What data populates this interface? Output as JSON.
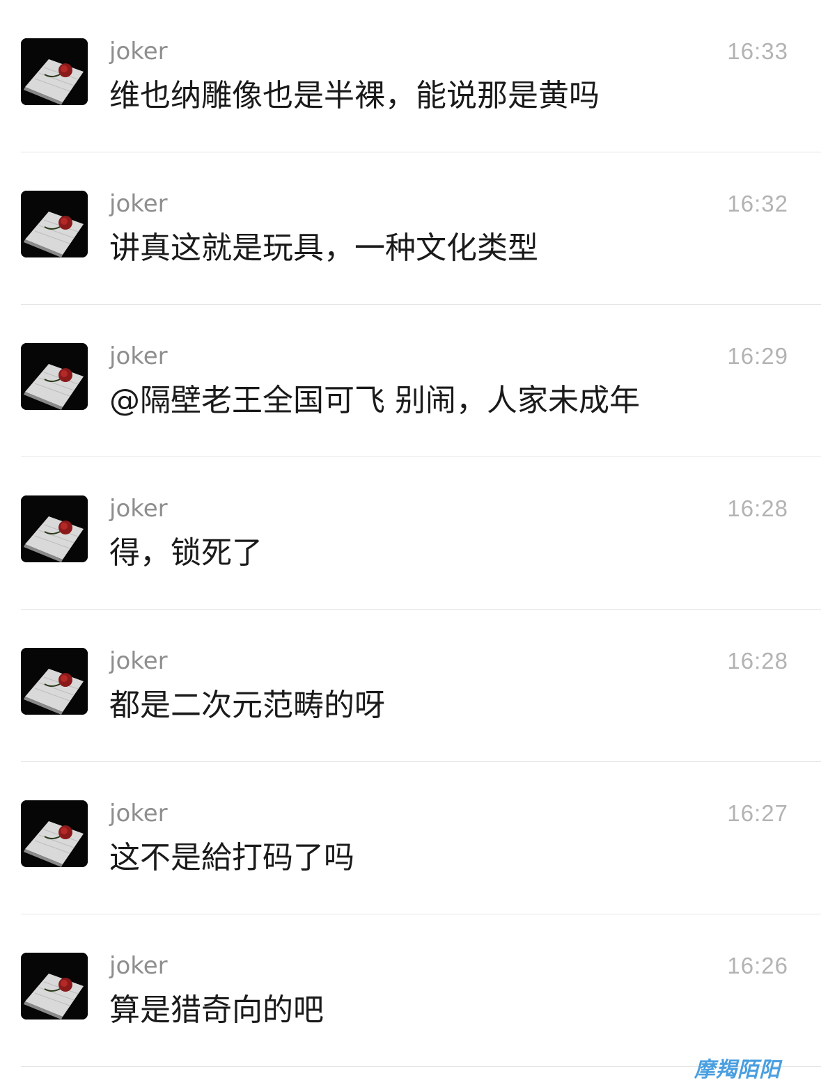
{
  "messages": [
    {
      "sender": "joker",
      "time": "16:33",
      "text": "维也纳雕像也是半裸，能说那是黄吗"
    },
    {
      "sender": "joker",
      "time": "16:32",
      "text": "讲真这就是玩具，一种文化类型"
    },
    {
      "sender": "joker",
      "time": "16:29",
      "text": "@隔壁老王全国可飞 别闹，人家未成年"
    },
    {
      "sender": "joker",
      "time": "16:28",
      "text": "得，锁死了"
    },
    {
      "sender": "joker",
      "time": "16:28",
      "text": "都是二次元范畴的呀"
    },
    {
      "sender": "joker",
      "time": "16:27",
      "text": "这不是給打码了吗"
    },
    {
      "sender": "joker",
      "time": "16:26",
      "text": "算是猎奇向的吧"
    }
  ],
  "avatar_icon": "book-with-rose-avatar",
  "watermark": "摩羯陌阳",
  "colors": {
    "sender": "#8e8e8e",
    "time": "#b3b3b3",
    "message": "#1a1a1a",
    "divider": "#e5e5e5",
    "watermark": "#4a9fe0"
  }
}
